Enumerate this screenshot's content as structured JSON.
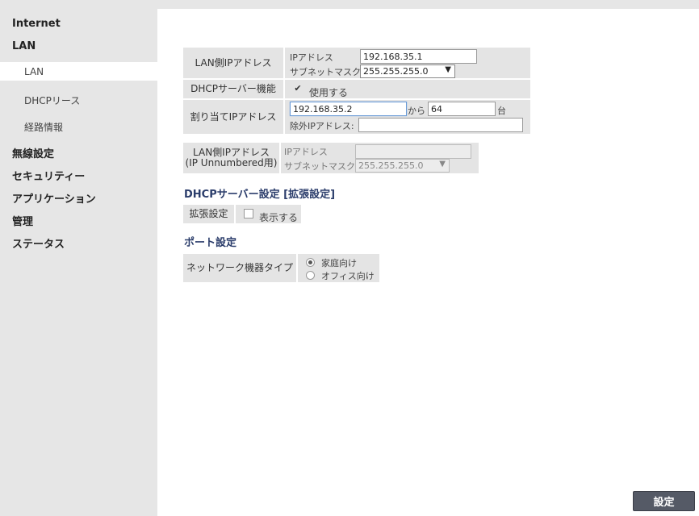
{
  "sidebar": {
    "items": [
      {
        "label": "Internet"
      },
      {
        "label": "LAN"
      },
      {
        "label": "LAN"
      },
      {
        "label": "DHCPリース"
      },
      {
        "label": "経路情報"
      },
      {
        "label": "無線設定"
      },
      {
        "label": "セキュリティー"
      },
      {
        "label": "アプリケーション"
      },
      {
        "label": "管理"
      },
      {
        "label": "ステータス"
      }
    ]
  },
  "lan_ip": {
    "header": "LAN側IPアドレス",
    "ip_label": "IPアドレス",
    "ip_value": "192.168.35.1",
    "mask_label": "サブネットマスク",
    "mask_value": "255.255.255.0"
  },
  "dhcp_server": {
    "header": "DHCPサーバー機能",
    "checkbox_label": "使用する",
    "checked": true
  },
  "assign_ip": {
    "header": "割り当てIPアドレス",
    "start_value": "192.168.35.2",
    "from_label": "から",
    "count_value": "64",
    "unit_label": "台",
    "exclude_label": "除外IPアドレス:",
    "exclude_value": ""
  },
  "unnumbered": {
    "header_line1": "LAN側IPアドレス",
    "header_line2": "(IP Unnumbered用)",
    "ip_label": "IPアドレス",
    "ip_value": "",
    "mask_label": "サブネットマスク",
    "mask_value": "255.255.255.0"
  },
  "dhcp_ext": {
    "title": "DHCPサーバー設定 [拡張設定]",
    "header": "拡張設定",
    "checkbox_label": "表示する",
    "checked": false
  },
  "port": {
    "title": "ポート設定",
    "header": "ネットワーク機器タイプ",
    "options": [
      "家庭向け",
      "オフィス向け"
    ],
    "selected": "家庭向け"
  },
  "apply_label": "設定",
  "icons": {
    "dropdown": "chevron-down-icon",
    "check": "checkmark-icon",
    "check_glyph": "✔",
    "arrow_glyph": "▼"
  }
}
